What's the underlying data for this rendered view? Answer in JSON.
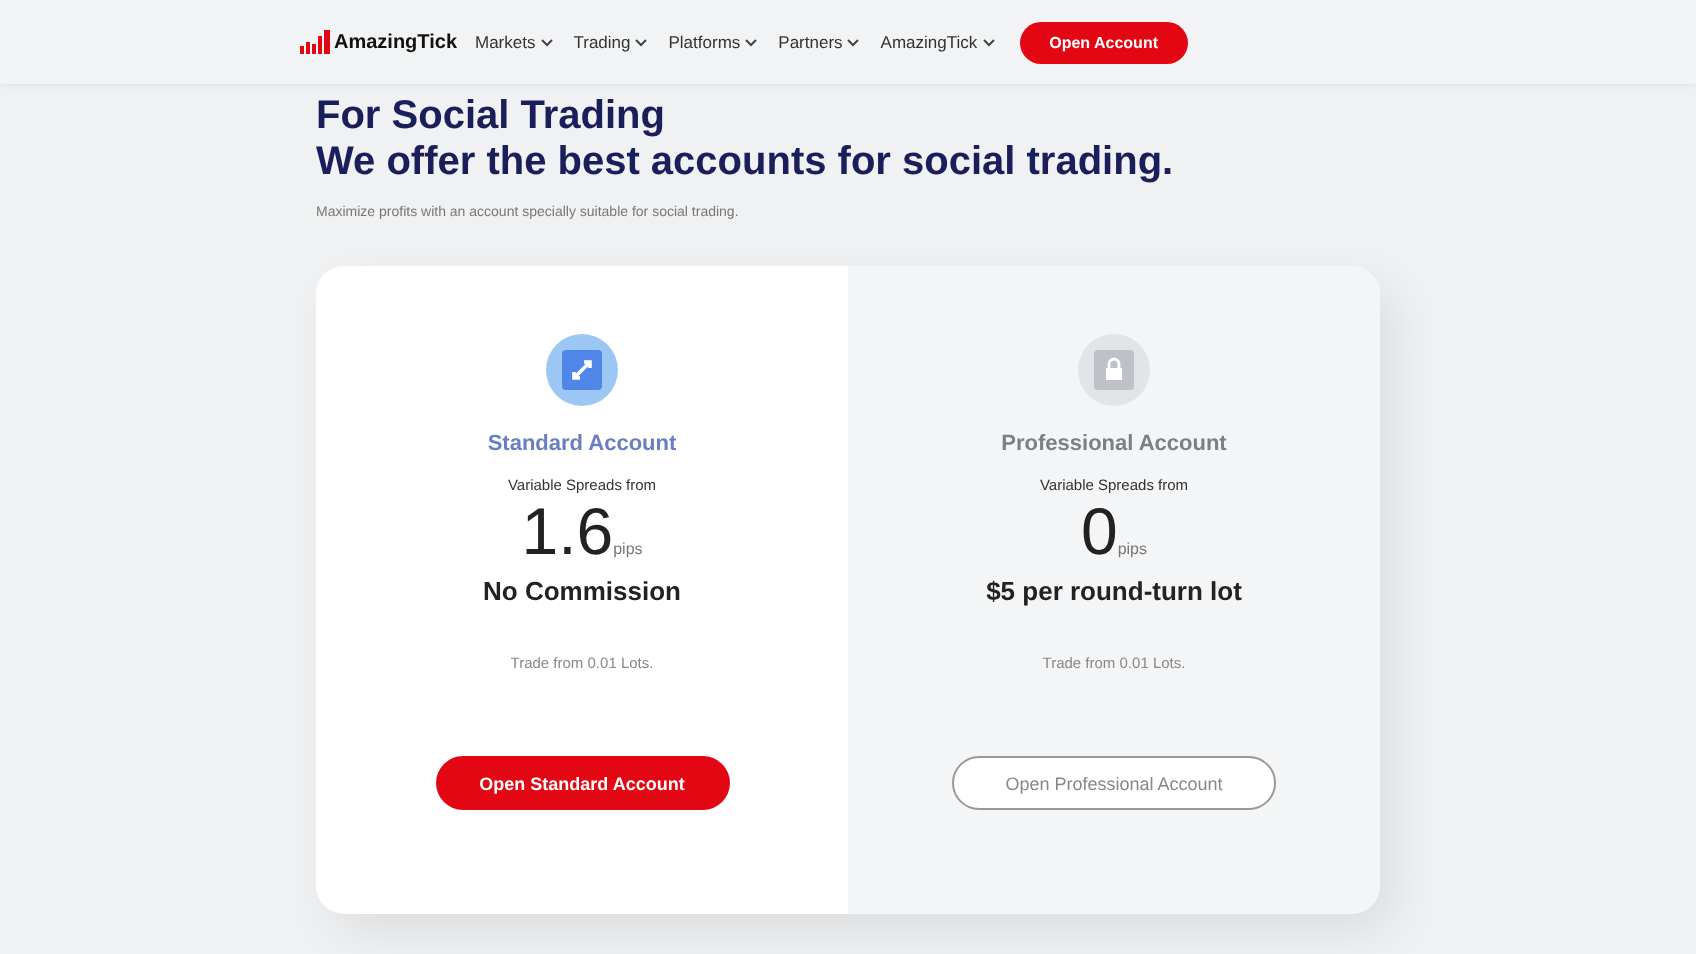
{
  "header": {
    "logo": "AmazingTick",
    "nav": [
      {
        "label": "Markets"
      },
      {
        "label": "Trading"
      },
      {
        "label": "Platforms"
      },
      {
        "label": "Partners"
      },
      {
        "label": "AmazingTick"
      }
    ],
    "cta": "Open Account"
  },
  "hero": {
    "title_line_1": "For Social Trading",
    "title_line_2": "We offer the best accounts for social trading.",
    "subtitle": "Maximize profits with an account specially suitable for social trading."
  },
  "accounts": [
    {
      "kind": "standard",
      "selected": true,
      "name": "Standard Account",
      "spread_label": "Variable Spreads from",
      "spread": "1.6",
      "unit": "pips",
      "commission": "No Commission",
      "min_trade": "Trade from 0.01 Lots.",
      "button": "Open Standard Account"
    },
    {
      "kind": "professional",
      "selected": false,
      "name": "Professional Account",
      "spread_label": "Variable Spreads from",
      "spread": "0",
      "unit": "pips",
      "commission": "$5 per round-turn lot",
      "min_trade": "Trade from 0.01 Lots.",
      "button": "Open Professional Account"
    }
  ]
}
